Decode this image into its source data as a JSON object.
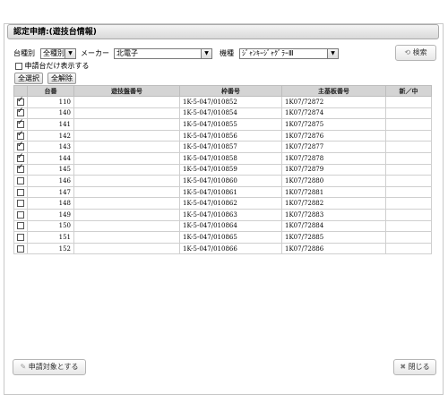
{
  "header": {
    "title": "認定申請:(遊技台情報)"
  },
  "filters": {
    "kind_label": "台種別",
    "kind_value": "全種別",
    "maker_label": "メーカー",
    "maker_value": "北電子",
    "model_label": "機種",
    "model_value": "ｼﾞｬﾝｷｰｼﾞｬｸﾞﾗｰⅢ",
    "search_label": "検索",
    "only_applying_label": "申請台だけ表示する"
  },
  "toolbar": {
    "select_all": "全選択",
    "deselect_all": "全解除"
  },
  "table": {
    "columns": [
      "",
      "台番",
      "遊技盤番号",
      "枠番号",
      "主基板番号",
      "新／中"
    ],
    "rows": [
      {
        "checked": true,
        "num": "110",
        "board": "",
        "frame": "1K-5-047/010852",
        "main": "1K07/72872",
        "status": ""
      },
      {
        "checked": true,
        "num": "140",
        "board": "",
        "frame": "1K-5-047/010854",
        "main": "1K07/72874",
        "status": ""
      },
      {
        "checked": true,
        "num": "141",
        "board": "",
        "frame": "1K-5-047/010855",
        "main": "1K07/72875",
        "status": ""
      },
      {
        "checked": true,
        "num": "142",
        "board": "",
        "frame": "1K-5-047/010856",
        "main": "1K07/72876",
        "status": ""
      },
      {
        "checked": true,
        "num": "143",
        "board": "",
        "frame": "1K-5-047/010857",
        "main": "1K07/72877",
        "status": ""
      },
      {
        "checked": true,
        "num": "144",
        "board": "",
        "frame": "1K-5-047/010858",
        "main": "1K07/72878",
        "status": ""
      },
      {
        "checked": true,
        "num": "145",
        "board": "",
        "frame": "1K-5-047/010859",
        "main": "1K07/72879",
        "status": ""
      },
      {
        "checked": false,
        "num": "146",
        "board": "",
        "frame": "1K-5-047/010860",
        "main": "1K07/72880",
        "status": ""
      },
      {
        "checked": false,
        "num": "147",
        "board": "",
        "frame": "1K-5-047/010861",
        "main": "1K07/72881",
        "status": ""
      },
      {
        "checked": false,
        "num": "148",
        "board": "",
        "frame": "1K-5-047/010862",
        "main": "1K07/72882",
        "status": ""
      },
      {
        "checked": false,
        "num": "149",
        "board": "",
        "frame": "1K-5-047/010863",
        "main": "1K07/72883",
        "status": ""
      },
      {
        "checked": false,
        "num": "150",
        "board": "",
        "frame": "1K-5-047/010864",
        "main": "1K07/72884",
        "status": ""
      },
      {
        "checked": false,
        "num": "151",
        "board": "",
        "frame": "1K-5-047/010865",
        "main": "1K07/72885",
        "status": ""
      },
      {
        "checked": false,
        "num": "152",
        "board": "",
        "frame": "1K-5-047/010866",
        "main": "1K07/72886",
        "status": ""
      }
    ]
  },
  "footer": {
    "apply_label": "申請対象とする",
    "close_label": "閉じる"
  }
}
